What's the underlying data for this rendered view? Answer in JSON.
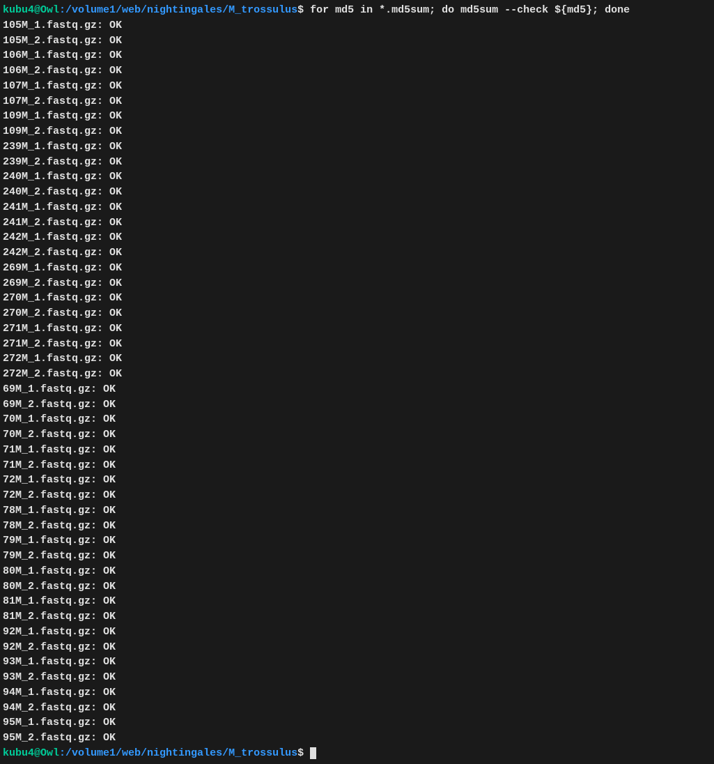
{
  "prompt1": {
    "user": "kubu4@Owl",
    "colon": ":",
    "path": "/volume1/web/nightingales/M_trossulus",
    "dollar": "$ ",
    "command": "for md5 in *.md5sum; do md5sum --check ${md5}; done"
  },
  "results": [
    "105M_1.fastq.gz: OK",
    "105M_2.fastq.gz: OK",
    "106M_1.fastq.gz: OK",
    "106M_2.fastq.gz: OK",
    "107M_1.fastq.gz: OK",
    "107M_2.fastq.gz: OK",
    "109M_1.fastq.gz: OK",
    "109M_2.fastq.gz: OK",
    "239M_1.fastq.gz: OK",
    "239M_2.fastq.gz: OK",
    "240M_1.fastq.gz: OK",
    "240M_2.fastq.gz: OK",
    "241M_1.fastq.gz: OK",
    "241M_2.fastq.gz: OK",
    "242M_1.fastq.gz: OK",
    "242M_2.fastq.gz: OK",
    "269M_1.fastq.gz: OK",
    "269M_2.fastq.gz: OK",
    "270M_1.fastq.gz: OK",
    "270M_2.fastq.gz: OK",
    "271M_1.fastq.gz: OK",
    "271M_2.fastq.gz: OK",
    "272M_1.fastq.gz: OK",
    "272M_2.fastq.gz: OK",
    "69M_1.fastq.gz: OK",
    "69M_2.fastq.gz: OK",
    "70M_1.fastq.gz: OK",
    "70M_2.fastq.gz: OK",
    "71M_1.fastq.gz: OK",
    "71M_2.fastq.gz: OK",
    "72M_1.fastq.gz: OK",
    "72M_2.fastq.gz: OK",
    "78M_1.fastq.gz: OK",
    "78M_2.fastq.gz: OK",
    "79M_1.fastq.gz: OK",
    "79M_2.fastq.gz: OK",
    "80M_1.fastq.gz: OK",
    "80M_2.fastq.gz: OK",
    "81M_1.fastq.gz: OK",
    "81M_2.fastq.gz: OK",
    "92M_1.fastq.gz: OK",
    "92M_2.fastq.gz: OK",
    "93M_1.fastq.gz: OK",
    "93M_2.fastq.gz: OK",
    "94M_1.fastq.gz: OK",
    "94M_2.fastq.gz: OK",
    "95M_1.fastq.gz: OK",
    "95M_2.fastq.gz: OK"
  ],
  "prompt2": {
    "user": "kubu4@Owl",
    "colon": ":",
    "path": "/volume1/web/nightingales/M_trossulus",
    "dollar": "$ "
  }
}
